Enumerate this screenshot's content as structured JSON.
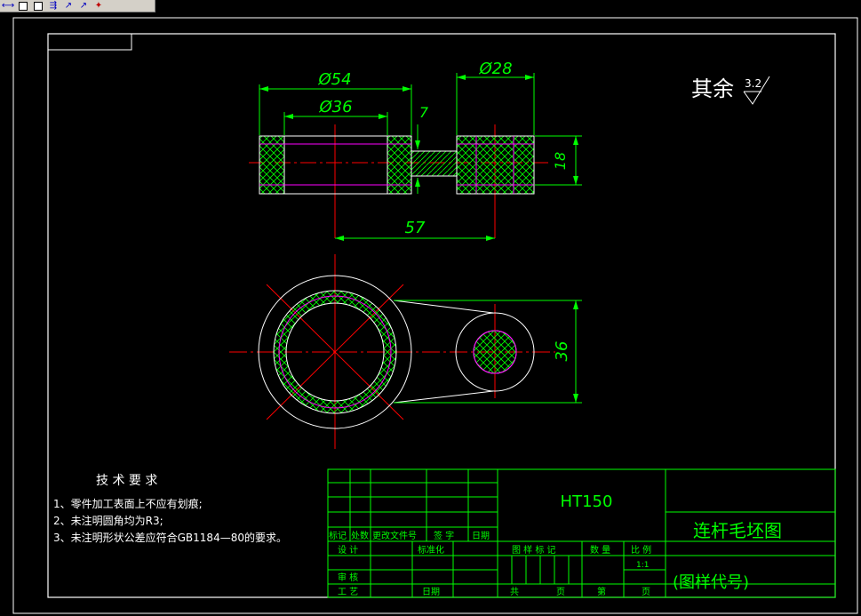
{
  "toolbar": {
    "buttons": [
      "dimension-linear-icon",
      "rectangle-icon",
      "rectangle-icon",
      "dimension-baseline-icon",
      "arrow-icon",
      "arrow-icon",
      "mirror-icon"
    ]
  },
  "colors": {
    "background": "#000000",
    "border": "#ffffff",
    "dimension": "#00ff00",
    "centerline": "#ff0000",
    "hidden": "#ff00ff",
    "hatch": "#00ff00",
    "text": "#ffffff",
    "titleblock_text": "#00ff00"
  },
  "dimensions": {
    "d54": "Ø54",
    "d36": "Ø36",
    "d28": "Ø28",
    "w7": "7",
    "h18": "18",
    "l57": "57",
    "h36": "36"
  },
  "roughness": {
    "label": "其余",
    "value": "3.2"
  },
  "tech_requirements": {
    "title": "技 术 要 求",
    "items": [
      "1、零件加工表面上不应有划痕;",
      "2、未注明圆角均为R3;",
      "3、未注明形状公差应符合GB1184—80的要求。"
    ]
  },
  "title_block": {
    "material": "HT150",
    "part_name": "连杆毛坯图",
    "drawing_no": "(图样代号)",
    "rev_headers": [
      "标记",
      "处数",
      "更改文件号",
      "签 字",
      "日期"
    ],
    "design": "设 计",
    "standardize": "标准化",
    "review": "审 核",
    "process": "工 艺",
    "date": "日期",
    "mark_label": "图 样 标 记",
    "qty_label": "数 量",
    "scale_label": "比 例",
    "scale_value": "1:1",
    "total": "共",
    "page": "页",
    "sheet": "第",
    "page2": "页"
  }
}
